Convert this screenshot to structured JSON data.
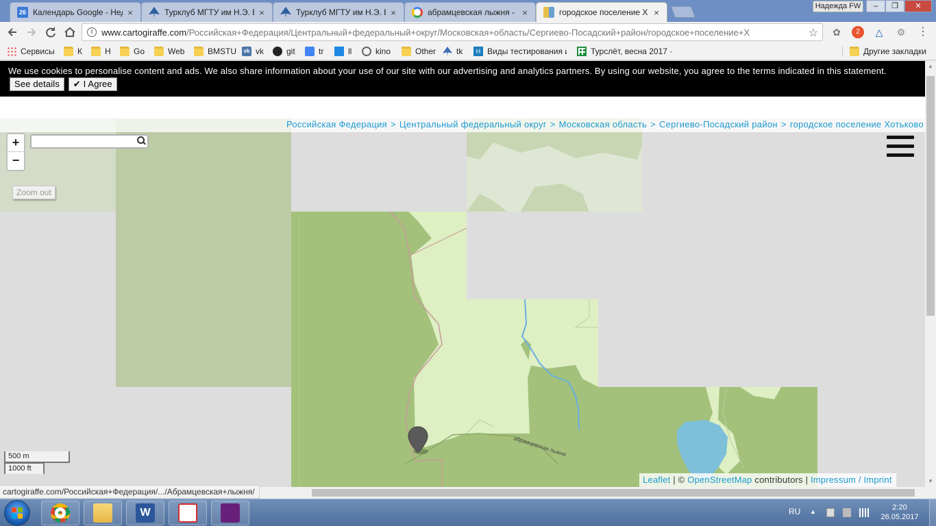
{
  "browser": {
    "tabs": [
      {
        "title": "Календарь Google - Нед",
        "favicon": "calendar-icon",
        "badge": "26"
      },
      {
        "title": "Турклуб МГТУ им Н.Э. Б",
        "favicon": "plane-icon"
      },
      {
        "title": "Турклуб МГТУ им Н.Э. Б",
        "favicon": "plane-icon"
      },
      {
        "title": "абрамцевская лыжня - ",
        "favicon": "google-icon"
      },
      {
        "title": "городское поселение Х",
        "favicon": "cartogiraffe-icon"
      }
    ],
    "profile_name": "Надежда FW",
    "window_buttons": {
      "minimize": "–",
      "maximize": "❐",
      "close": "✕"
    },
    "url_host": "www.cartogiraffe.com",
    "url_path": "/Российская+Федерация/Центральный+федеральный+округ/Московская+область/Сергиево-Посадский+район/городское+поселение+Х",
    "extension_badge": "2"
  },
  "bookmarks": [
    {
      "label": "Сервисы",
      "icon": "apps-icon"
    },
    {
      "label": "К",
      "icon": "folder-icon"
    },
    {
      "label": "Н",
      "icon": "folder-icon"
    },
    {
      "label": "Go",
      "icon": "folder-icon"
    },
    {
      "label": "Web",
      "icon": "folder-icon"
    },
    {
      "label": "BMSTU",
      "icon": "folder-icon"
    },
    {
      "label": "vk",
      "icon": "vk-icon"
    },
    {
      "label": "git",
      "icon": "github-icon"
    },
    {
      "label": "tr",
      "icon": "translate-icon"
    },
    {
      "label": "ll",
      "icon": "book-icon"
    },
    {
      "label": "kino",
      "icon": "film-icon"
    },
    {
      "label": "Other",
      "icon": "folder-icon"
    },
    {
      "label": "tk",
      "icon": "plane-icon"
    },
    {
      "label": "Виды тестирования и",
      "icon": "h-icon"
    },
    {
      "label": "Турслёт, весна 2017 ·",
      "icon": "sheets-icon"
    }
  ],
  "other_bookmarks": "Другие закладки",
  "cookie_banner": {
    "text": "We use cookies to personalise content and ads. We also share information about your use of our site with our advertising and analytics partners. By using our website, you agree to the terms indicated in this statement.",
    "details_label": "See details",
    "agree_label": "I Agree"
  },
  "breadcrumbs": [
    "Российская Федерация",
    "Центральный федеральный округ",
    "Московская область",
    "Сергиево-Посадский район",
    "городское поселение Хотьково"
  ],
  "breadcrumb_separator": ">",
  "map": {
    "zoom_in": "+",
    "zoom_out": "−",
    "zoom_out_button": "Zoom out",
    "search_placeholder": "",
    "scale_metric": "500 m",
    "scale_imperial": "1000 ft",
    "trail_label": "абрамцевская лыжня",
    "attribution": {
      "leaflet": "Leaflet",
      "divider": "|",
      "copyright": "©",
      "osm": "OpenStreetMap",
      "contributors": "contributors",
      "divider2": "|",
      "impressum": "Impressum / Imprint"
    },
    "colors": {
      "forest": "#a3c17b",
      "meadow": "#ddefc3",
      "water": "#7ec0d9",
      "background": "#dddddd",
      "boundary": "#c99a9a"
    }
  },
  "status_url": "cartogiraffe.com/Российская+Федерация/.../Абрамцевская+лыжня/",
  "taskbar": {
    "apps": [
      "chrome-icon",
      "explorer-icon",
      "word-icon",
      "acrobat-icon",
      "visual-studio-icon"
    ],
    "language": "RU",
    "time": "2:20",
    "date": "26.05.2017"
  }
}
